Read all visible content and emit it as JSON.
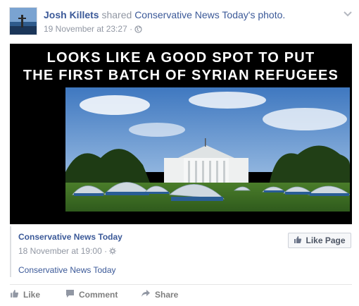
{
  "post": {
    "author": "Josh Killets",
    "shared_word": "shared",
    "shared_page": "Conservative News Today",
    "shared_suffix": "'s photo.",
    "timestamp": "19 November at 23:27",
    "separator": "·"
  },
  "photo": {
    "caption_line1": "LOOKS LIKE A GOOD SPOT TO PUT",
    "caption_line2": "THE FIRST BATCH OF SYRIAN REFUGEES"
  },
  "shared_box": {
    "page_name": "Conservative News Today",
    "date": "18 November at 19:00",
    "separator": "·",
    "description": "Conservative News Today",
    "like_page_label": "Like Page"
  },
  "actions": {
    "like": "Like",
    "comment": "Comment",
    "share": "Share"
  },
  "colors": {
    "link": "#3b5998",
    "muted": "#9197a3",
    "action_text": "#7f7f7f"
  }
}
